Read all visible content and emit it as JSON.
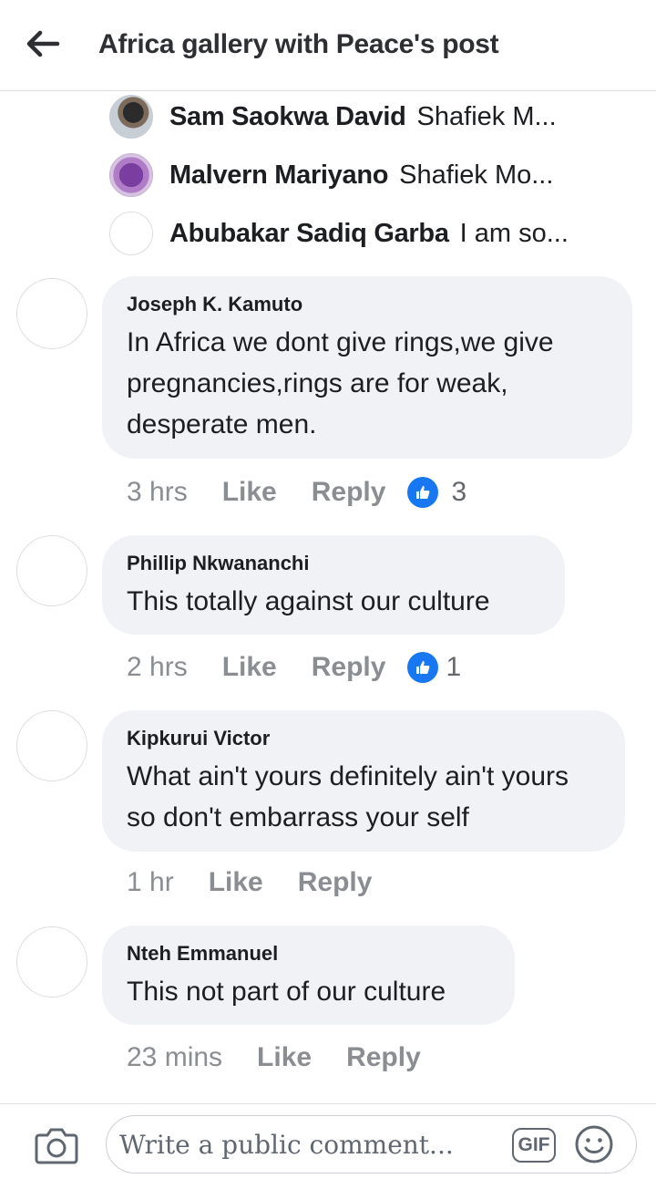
{
  "header": {
    "title": "Africa gallery with Peace's post",
    "back_icon": "arrow-left-icon"
  },
  "reply_previews": [
    {
      "name": "Sam Saokwa David",
      "text": "Shafiek M...",
      "avatar": "photo"
    },
    {
      "name": "Malvern Mariyano",
      "text": "Shafiek Mo...",
      "avatar": "photo"
    },
    {
      "name": "Abubakar Sadiq Garba",
      "text": "I am so...",
      "avatar": "blank"
    }
  ],
  "comments": [
    {
      "author": "Joseph K. Kamuto",
      "text": "In Africa we dont give rings,we give pregnancies,rings are for weak, desperate men.",
      "time": "3 hrs",
      "like_label": "Like",
      "reply_label": "Reply",
      "reaction_count": "3"
    },
    {
      "author": "Phillip Nkwananchi",
      "text": "This totally against our culture",
      "time": "2 hrs",
      "like_label": "Like",
      "reply_label": "Reply",
      "reaction_count": "1"
    },
    {
      "author": "Kipkurui Victor",
      "text": "What ain't yours definitely ain't yours so don't embarrass your self",
      "time": "1 hr",
      "like_label": "Like",
      "reply_label": "Reply"
    },
    {
      "author": "Nteh Emmanuel",
      "text": "This not part of our culture",
      "time": "23 mins",
      "like_label": "Like",
      "reply_label": "Reply"
    }
  ],
  "composer": {
    "placeholder": "Write a public comment...",
    "gif_label": "GIF",
    "camera_icon": "camera-icon",
    "emoji_icon": "smiley-icon"
  },
  "colors": {
    "like_blue": "#1877f2",
    "bubble_bg": "#f0f2f5",
    "meta_gray": "#8a8d91"
  }
}
